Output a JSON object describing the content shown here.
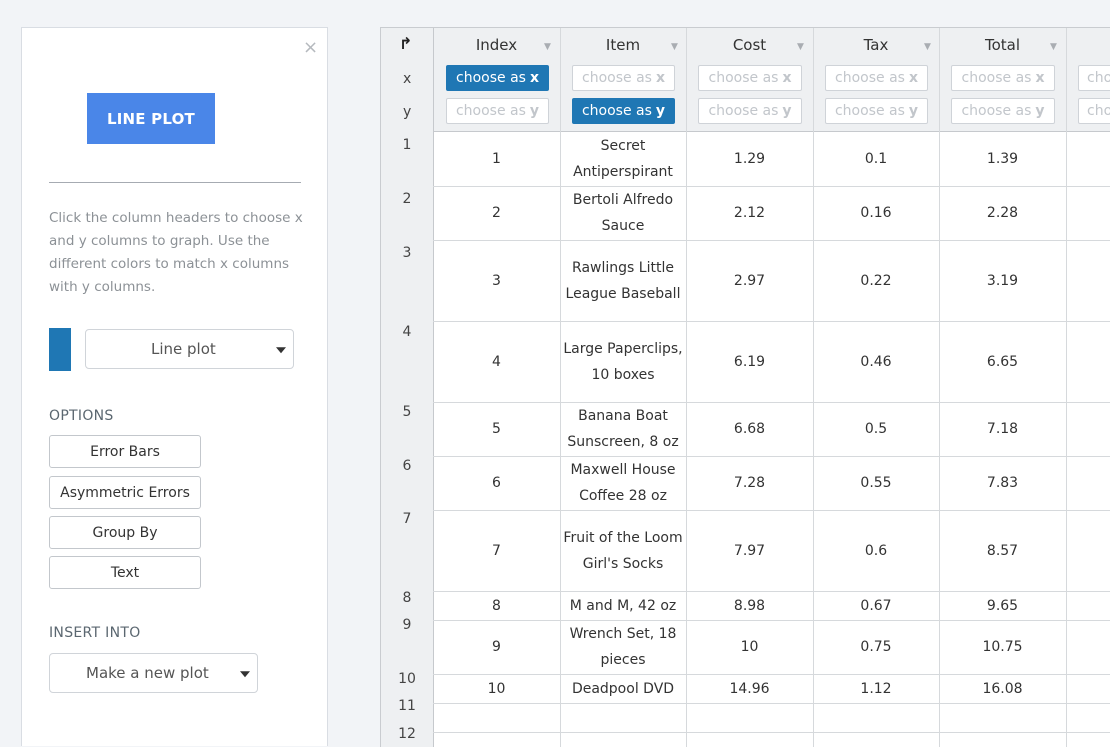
{
  "panel": {
    "close_icon": "×",
    "plot_button": "LINE PLOT",
    "instructions": "Click the column headers to choose x and y columns to graph. Use the different colors to match x columns with y columns.",
    "series_color": "#1f77b4",
    "plot_type_select": "Line plot",
    "options_heading": "OPTIONS",
    "options": [
      "Error Bars",
      "Asymmetric Errors",
      "Group By",
      "Text"
    ],
    "insert_heading": "INSERT INTO",
    "insert_select": "Make a new plot"
  },
  "sheet": {
    "axis_labels": {
      "x": "x",
      "y": "y"
    },
    "choose_x": "choose as",
    "choose_y": "choose as",
    "x_letter": "x",
    "y_letter": "y",
    "columns": [
      "Index",
      "Item",
      "Cost",
      "Tax",
      "Total"
    ],
    "selected_x_column": "Index",
    "selected_y_column": "Item",
    "row_numbers": [
      "1",
      "2",
      "3",
      "4",
      "5",
      "6",
      "7",
      "8",
      "9",
      "10",
      "11",
      "12"
    ],
    "rows": [
      [
        "1",
        "Secret Antiperspirant",
        "1.29",
        "0.1",
        "1.39"
      ],
      [
        "2",
        "Bertoli Alfredo Sauce",
        "2.12",
        "0.16",
        "2.28"
      ],
      [
        "3",
        "Rawlings Little League Baseball",
        "2.97",
        "0.22",
        "3.19"
      ],
      [
        "4",
        "Large Paperclips, 10 boxes",
        "6.19",
        "0.46",
        "6.65"
      ],
      [
        "5",
        "Banana Boat Sunscreen, 8 oz",
        "6.68",
        "0.5",
        "7.18"
      ],
      [
        "6",
        "Maxwell House Coffee 28 oz",
        "7.28",
        "0.55",
        "7.83"
      ],
      [
        "7",
        "Fruit of the Loom Girl's Socks",
        "7.97",
        "0.6",
        "8.57"
      ],
      [
        "8",
        "M and M, 42 oz",
        "8.98",
        "0.67",
        "9.65"
      ],
      [
        "9",
        "Wrench Set, 18 pieces",
        "10",
        "0.75",
        "10.75"
      ],
      [
        "10",
        "Deadpool DVD",
        "14.96",
        "1.12",
        "16.08"
      ],
      [
        "",
        "",
        "",
        "",
        ""
      ],
      [
        "",
        "",
        "",
        "",
        ""
      ]
    ]
  }
}
